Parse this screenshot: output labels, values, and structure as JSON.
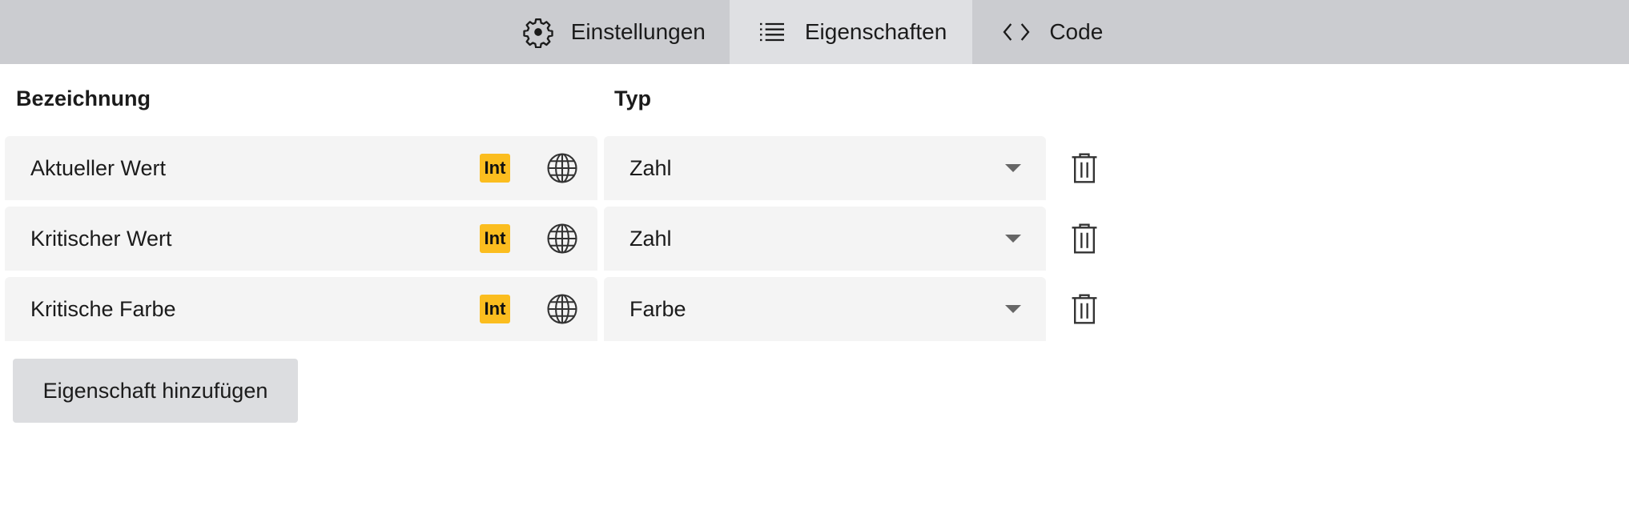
{
  "tabs": [
    {
      "label": "Einstellungen",
      "icon": "gear-icon"
    },
    {
      "label": "Eigenschaften",
      "icon": "list-icon"
    },
    {
      "label": "Code",
      "icon": "code-icon"
    }
  ],
  "active_tab": "Eigenschaften",
  "table": {
    "headers": {
      "name": "Bezeichnung",
      "type": "Typ"
    },
    "rows": [
      {
        "name": "Aktueller Wert",
        "badge": "Int",
        "type": "Zahl"
      },
      {
        "name": "Kritischer Wert",
        "badge": "Int",
        "type": "Zahl"
      },
      {
        "name": "Kritische Farbe",
        "badge": "Int",
        "type": "Farbe"
      }
    ]
  },
  "add_button": "Eigenschaft hinzufügen",
  "colors": {
    "tabbar": "#cbccd0",
    "active_tab": "#dfe0e3",
    "badge": "#fbbd1f",
    "field": "#f4f4f4",
    "button": "#dcdde0"
  }
}
